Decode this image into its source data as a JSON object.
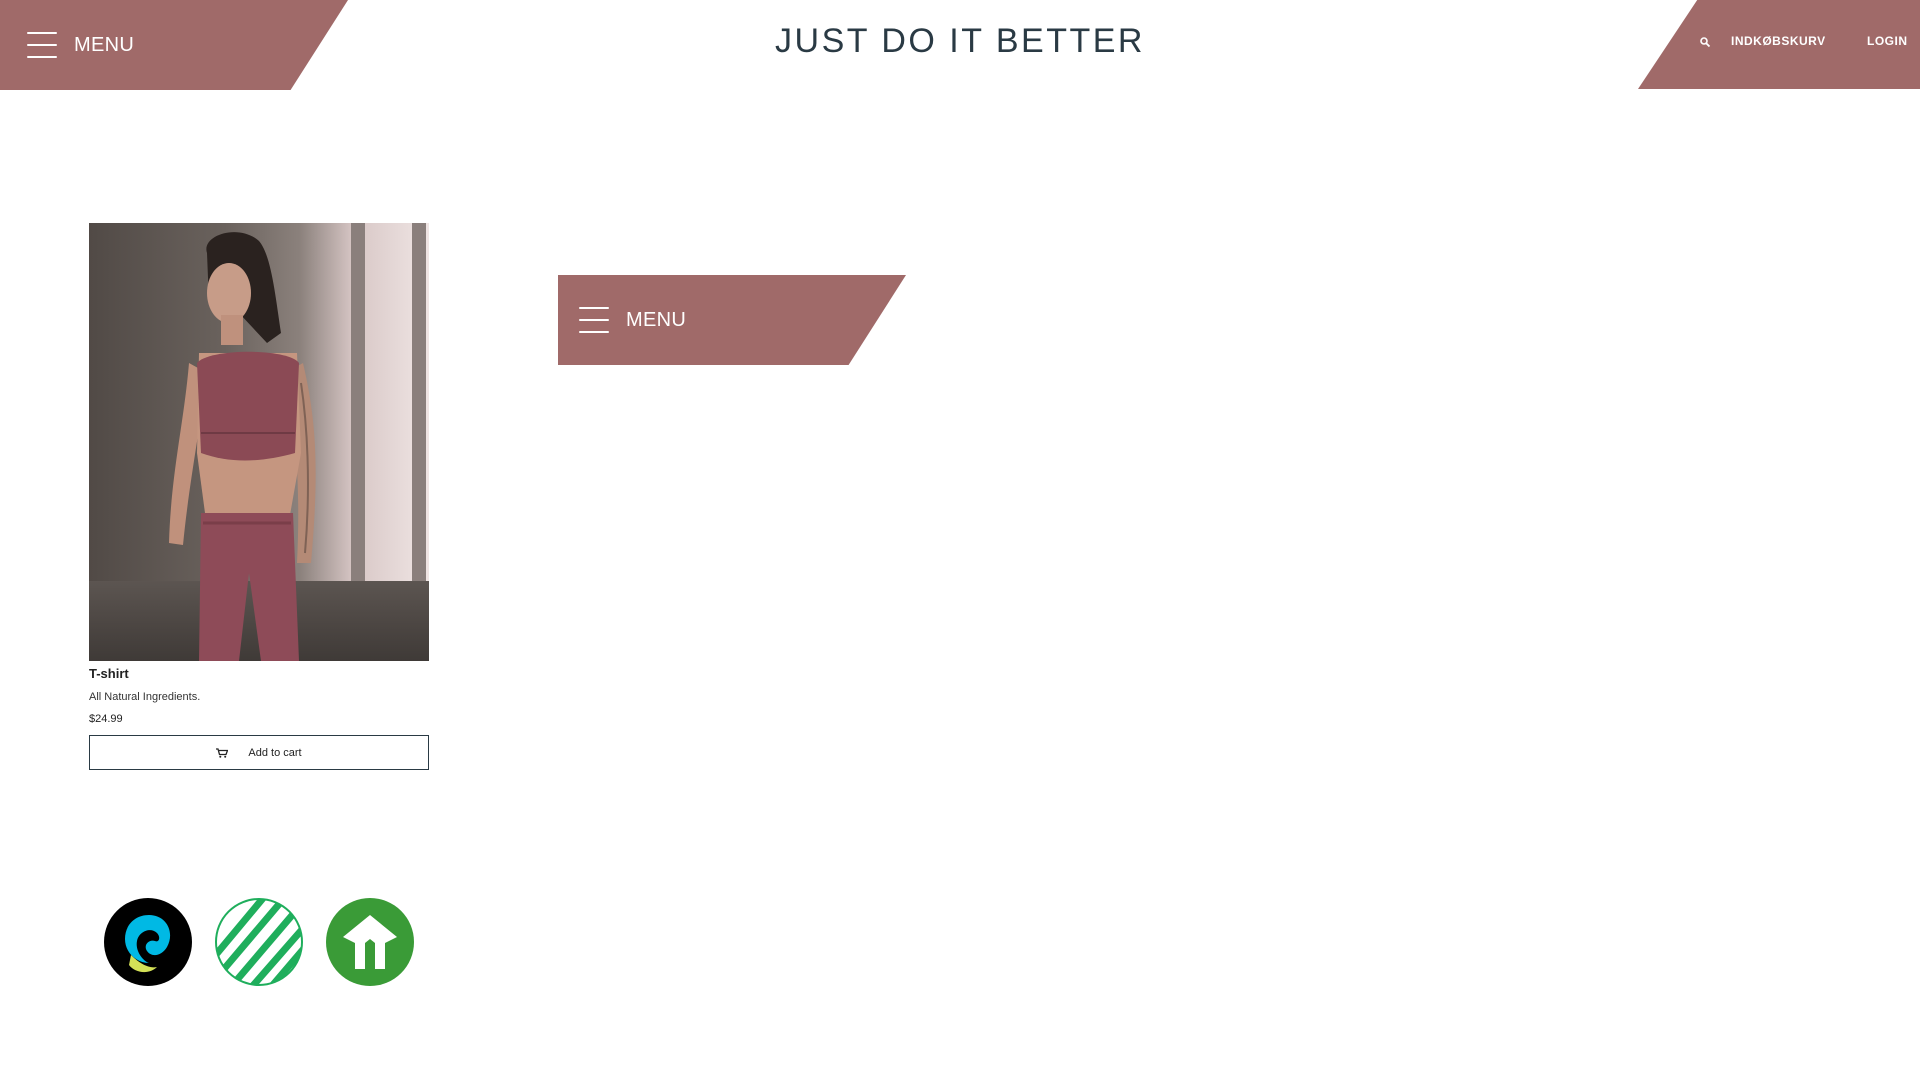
{
  "header": {
    "menu_label": "MENU",
    "title": "JUST DO IT BETTER",
    "nav": {
      "search_icon": "search-icon",
      "cart_label": "INDKØBSKURV",
      "login_label": "LOGIN"
    }
  },
  "overlay_menu": {
    "menu_label": "MENU"
  },
  "product": {
    "name": "T-shirt",
    "description": "All Natural Ingredients.",
    "price": "$24.99",
    "add_to_cart_label": "Add to cart",
    "cart_icon": "cart-icon"
  },
  "certifications": [
    {
      "icon": "fairtrade-logo-icon"
    },
    {
      "icon": "nordic-swan-logo-icon"
    },
    {
      "icon": "gots-organic-logo-icon"
    }
  ],
  "colors": {
    "accent": "#a06a69",
    "title": "#2a3a44",
    "background": "#ffffff"
  }
}
